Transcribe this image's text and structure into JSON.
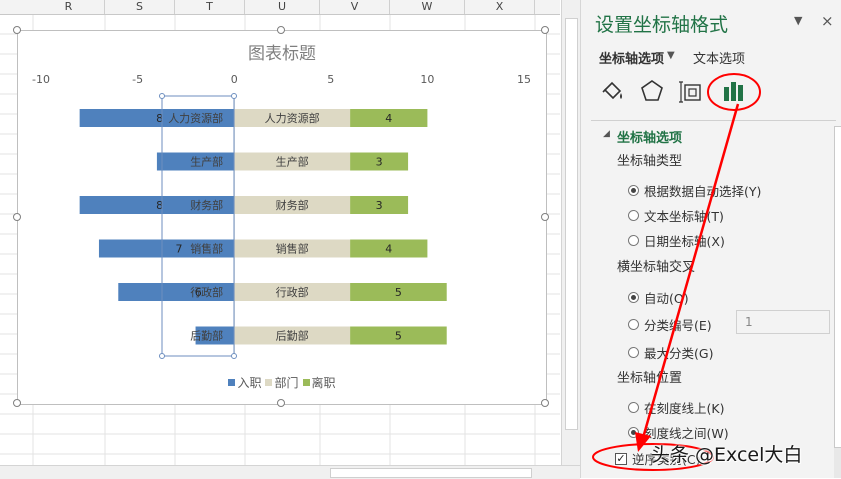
{
  "sheet": {
    "columns": [
      "R",
      "S",
      "T",
      "U",
      "V",
      "W",
      "X"
    ]
  },
  "colors": {
    "accent": "#217346",
    "onboard": "#4F81BD",
    "dept": "#DDD9C4",
    "leave": "#9BBB59",
    "annotation": "#FF0000"
  },
  "chart_data": {
    "type": "bar",
    "orientation": "horizontal",
    "stacked": true,
    "title": "图表标题",
    "categories": [
      "人力资源部",
      "生产部",
      "财务部",
      "销售部",
      "行政部",
      "后勤部"
    ],
    "series": [
      {
        "name": "入职",
        "values": [
          -8,
          -4,
          -8,
          -7,
          -6,
          -2
        ],
        "labels": [
          "8",
          "",
          "8",
          "7",
          "6",
          ""
        ]
      },
      {
        "name": "部门",
        "values": [
          6,
          6,
          6,
          6,
          6,
          6
        ],
        "labels": [
          "人力资源部",
          "生产部",
          "财务部",
          "销售部",
          "行政部",
          "后勤部"
        ]
      },
      {
        "name": "离职",
        "values": [
          4,
          3,
          3,
          4,
          5,
          5
        ],
        "labels": [
          "4",
          "3",
          "3",
          "4",
          "5",
          "5"
        ]
      }
    ],
    "axis_ticks": [
      "-10",
      "-5",
      "0",
      "5",
      "10",
      "15"
    ],
    "xlim": [
      -10,
      15
    ],
    "axis_position": "top",
    "categories_reversed": true,
    "legend_position": "bottom",
    "grid": false
  },
  "pane": {
    "title": "设置坐标轴格式",
    "close": "×",
    "dropdown": "▼",
    "tab_axis_options": "坐标轴选项",
    "tab_text_options": "文本选项",
    "icons": [
      "fill-bucket-icon",
      "pentagon-effects-icon",
      "size-properties-icon",
      "bar-chart-options-icon"
    ],
    "section_title": "坐标轴选项",
    "axis_type_label": "坐标轴类型",
    "axis_type_options": [
      "根据数据自动选择(Y)",
      "文本坐标轴(T)",
      "日期坐标轴(X)"
    ],
    "cross_label": "横坐标轴交叉",
    "cross_options": [
      "自动(O)",
      "分类编号(E)",
      "最大分类(G)"
    ],
    "cross_value": "1",
    "axis_position_label": "坐标轴位置",
    "axis_position_options": [
      "在刻度线上(K)",
      "刻度线之间(W)"
    ],
    "reverse_order_label": "逆序类别(C)"
  },
  "watermark": "头条 @Excel大白"
}
